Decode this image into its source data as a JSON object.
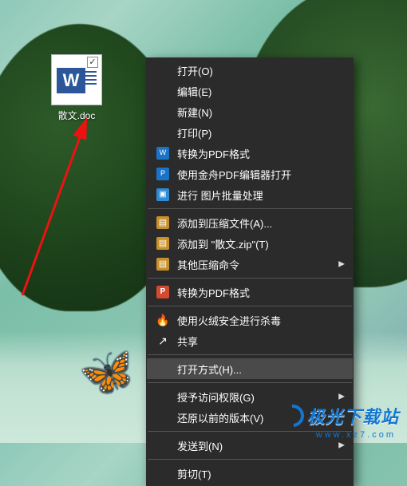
{
  "desktop_icon": {
    "label": "散文.doc",
    "glyph": "W"
  },
  "watermark": {
    "text": "极光下载站",
    "url": "www.xz7.com"
  },
  "menu": {
    "items": [
      {
        "label": "打开(O)"
      },
      {
        "label": "编辑(E)"
      },
      {
        "label": "新建(N)"
      },
      {
        "label": "打印(P)"
      }
    ],
    "pdf_group": [
      {
        "label": "转换为PDF格式"
      },
      {
        "label": "使用金舟PDF编辑器打开"
      },
      {
        "label": "进行 图片批量处理"
      }
    ],
    "zip_group": [
      {
        "label": "添加到压缩文件(A)..."
      },
      {
        "label": "添加到 \"散文.zip\"(T)"
      },
      {
        "label": "其他压缩命令",
        "submenu": true
      }
    ],
    "pdf2": {
      "label": "转换为PDF格式"
    },
    "av": {
      "label": "使用火绒安全进行杀毒"
    },
    "share": {
      "label": "共享"
    },
    "open_with": {
      "label": "打开方式(H)..."
    },
    "perm": {
      "label": "授予访问权限(G)",
      "submenu": true
    },
    "restore": {
      "label": "还原以前的版本(V)"
    },
    "sendto": {
      "label": "发送到(N)",
      "submenu": true
    },
    "cut": {
      "label": "剪切(T)"
    }
  }
}
